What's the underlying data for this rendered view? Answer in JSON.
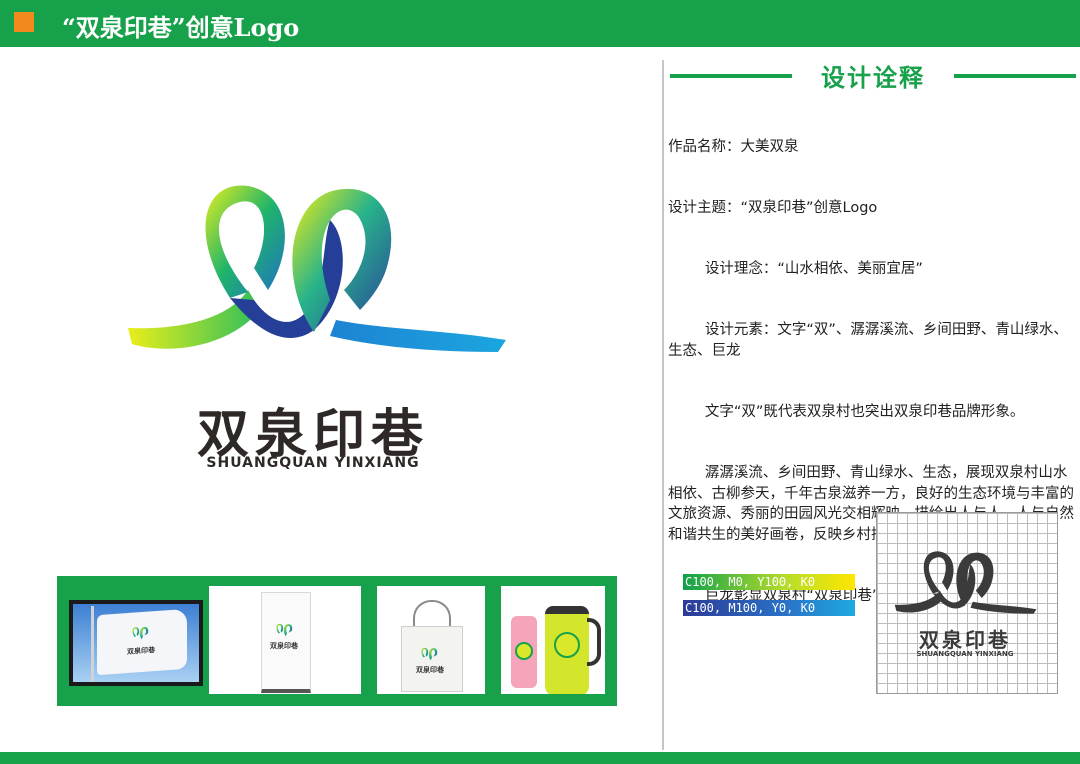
{
  "header": {
    "title": "“双泉印巷”创意Logo"
  },
  "brand": {
    "name_cn": "双泉印巷",
    "name_en": "SHUANGQUAN YINXIANG"
  },
  "design": {
    "section_title": "设计诠释",
    "paragraphs": [
      "作品名称：大美双泉",
      "设计主题：“双泉印巷”创意Logo",
      "        设计理念：“山水相依、美丽宜居”",
      "        设计元素：文字“双”、潺潺溪流、乡间田野、青山绿水、生态、巨龙",
      "        文字“双”既代表双泉村也突出双泉印巷品牌形象。",
      "        潺潺溪流、乡间田野、青山绿水、生态，展现双泉村山水相依、古柳参天，千年古泉滋养一方，良好的生态环境与丰富的文旅资源、秀丽的田园风光交相辉映，描绘出人与人、人与自然和谐共生的美好画卷，反映乡村振兴、和美乡村理念。",
      "        巨龙彰显双泉村“双泉印巷”蓬勃的发展和美好未来。"
    ]
  },
  "colors": {
    "brand_green": "#17a14a",
    "accent_orange": "#f08a1c",
    "swatch_1": "C100, M0, Y100, K0",
    "swatch_2": "C100, M100, Y0, K0"
  },
  "applications": {
    "items": [
      "flag",
      "roll-up-banner",
      "tote-bag",
      "cup-and-kettle"
    ]
  }
}
